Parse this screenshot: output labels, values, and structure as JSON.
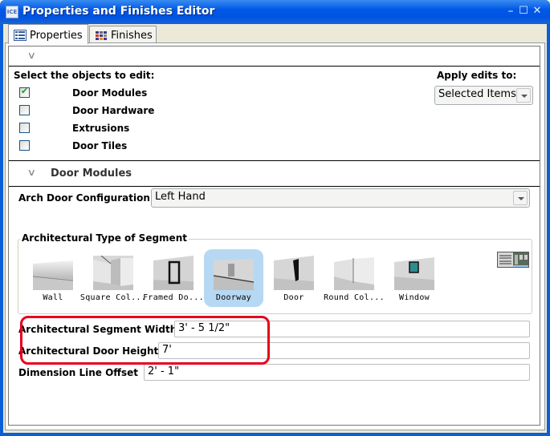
{
  "window": {
    "title": "Properties and Finishes Editor",
    "app_icon_text": "ICE",
    "controls": {
      "minimize": "–",
      "maximize": "☐",
      "close": "✕"
    }
  },
  "tabs": [
    {
      "label": "Properties",
      "icon": "list-icon",
      "active": true
    },
    {
      "label": "Finishes",
      "icon": "color-grid-icon",
      "active": false
    }
  ],
  "objects_section": {
    "heading": "Select the objects to edit:",
    "items": [
      {
        "label": "Door Modules",
        "checked": true
      },
      {
        "label": "Door Hardware",
        "checked": false
      },
      {
        "label": "Extrusions",
        "checked": false
      },
      {
        "label": "Door Tiles",
        "checked": false
      }
    ],
    "apply_label": "Apply edits to:",
    "apply_value": "Selected Items"
  },
  "door_modules": {
    "heading": "Door Modules",
    "config_label": "Arch Door Configuration",
    "config_value": "Left Hand",
    "segment_group_title": "Architectural Type of Segment",
    "segments": [
      {
        "label": "Wall",
        "selected": false
      },
      {
        "label": "Square Col...",
        "selected": false
      },
      {
        "label": "Framed Do...",
        "selected": false
      },
      {
        "label": "Doorway",
        "selected": true
      },
      {
        "label": "Door",
        "selected": false
      },
      {
        "label": "Round Col...",
        "selected": false
      },
      {
        "label": "Window",
        "selected": false
      }
    ],
    "fields": [
      {
        "label": "Architectural Segment Width",
        "value": "3' - 5 1/2\""
      },
      {
        "label": "Architectural Door Height",
        "value": "7'"
      },
      {
        "label": "Dimension Line Offset",
        "value": "2' - 1\""
      }
    ]
  },
  "colors": {
    "highlight": "#e8001c",
    "selection": "#b6d8f2",
    "titlebar": "#0054e3"
  }
}
